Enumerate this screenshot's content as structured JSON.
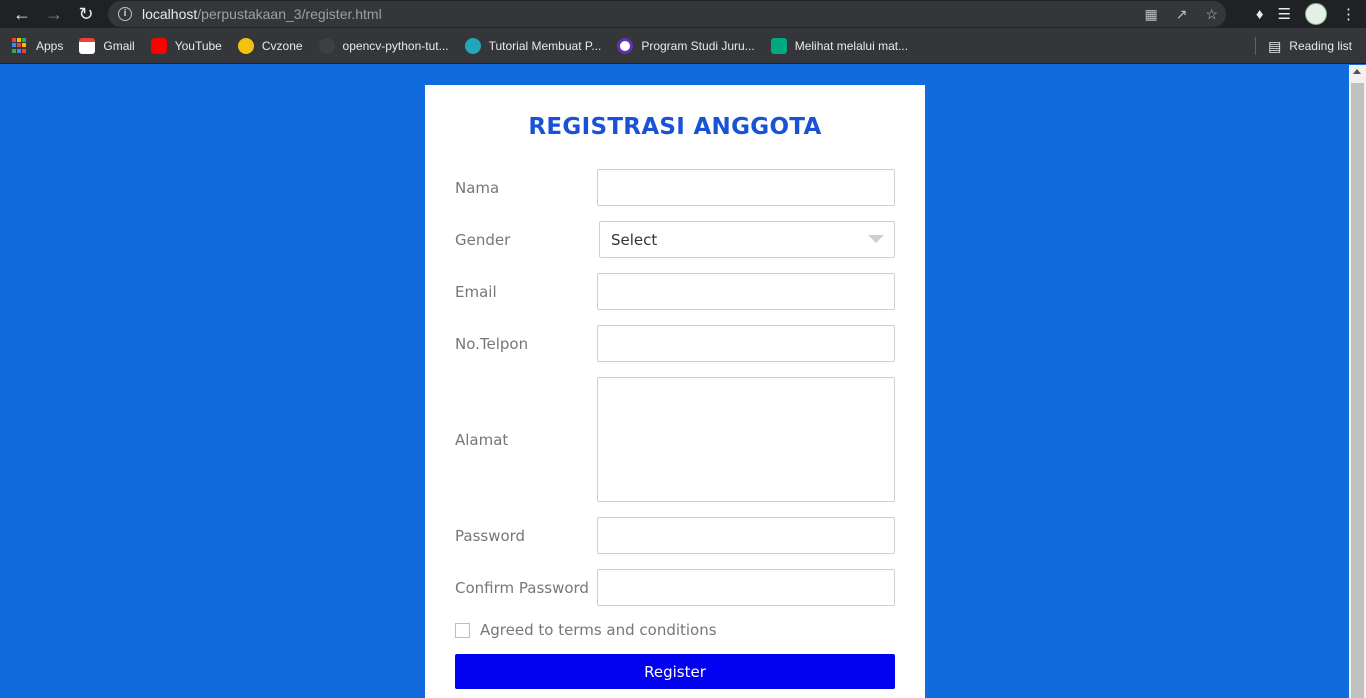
{
  "browser": {
    "url_host": "localhost",
    "url_path": "/perpustakaan_3/register.html",
    "bookmarks": [
      {
        "label": "Apps",
        "icon": "apps-grid-icon",
        "color": "#4285f4"
      },
      {
        "label": "Gmail",
        "icon": "gmail-icon",
        "color": "#ea4335"
      },
      {
        "label": "YouTube",
        "icon": "youtube-icon",
        "color": "#ff0000"
      },
      {
        "label": "Cvzone",
        "icon": "cvzone-icon",
        "color": "#f4c20d"
      },
      {
        "label": "opencv-python-tut...",
        "icon": "github-icon",
        "color": "#24292e"
      },
      {
        "label": "Tutorial Membuat P...",
        "icon": "web-icon",
        "color": "#21a7b8"
      },
      {
        "label": "Program Studi Juru...",
        "icon": "university-icon",
        "color": "#5e35b1"
      },
      {
        "label": "Melihat melalui mat...",
        "icon": "page-icon",
        "color": "#00a884"
      }
    ],
    "reading_list": "Reading list"
  },
  "form": {
    "title": "REGISTRASI ANGGOTA",
    "fields": {
      "nama": "Nama",
      "gender": "Gender",
      "email": "Email",
      "telpon": "No.Telpon",
      "alamat": "Alamat",
      "password": "Password",
      "confirm": "Confirm Password"
    },
    "gender_selected": "Select",
    "terms_label": "Agreed to terms and conditions",
    "register_label": "Register"
  },
  "colors": {
    "background": "#126bdc",
    "title": "#1a52d6",
    "button": "#0202f0",
    "checkbox_border": "#e6c04a"
  }
}
